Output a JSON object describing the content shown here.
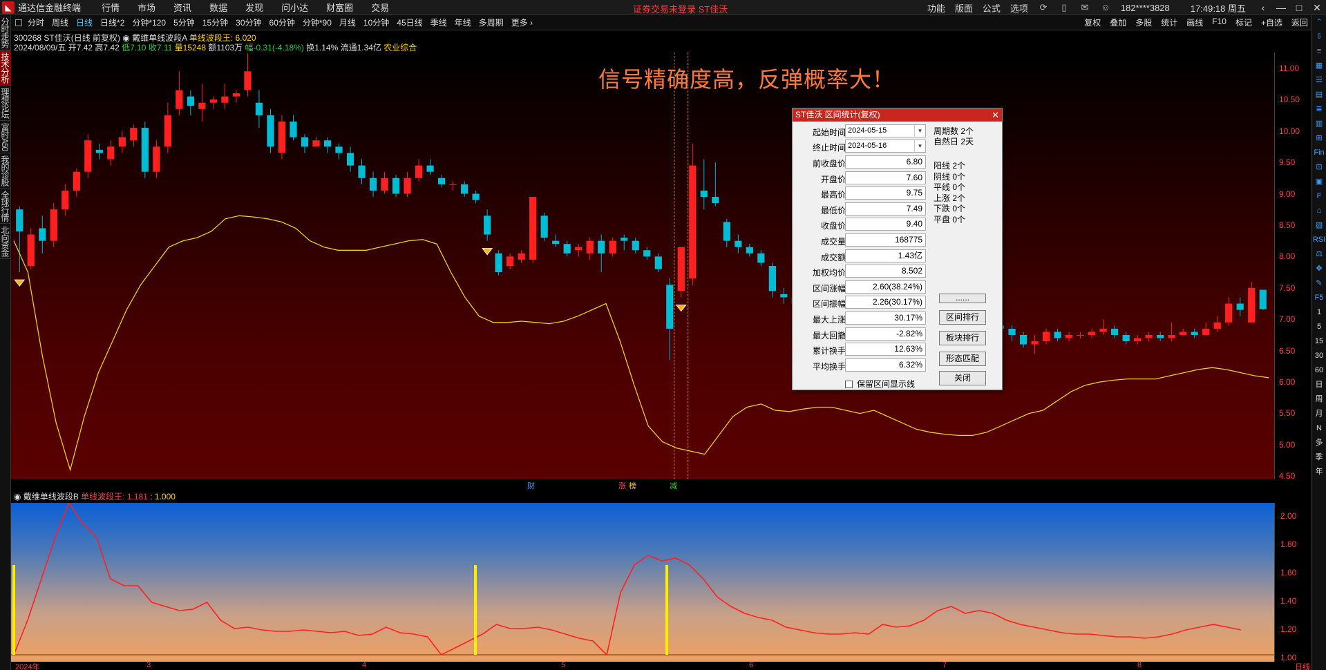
{
  "menubar": {
    "app_name": "通达信金融终端",
    "items": [
      "行情",
      "市场",
      "资讯",
      "数据",
      "发现",
      "问小达",
      "财富圈",
      "交易"
    ],
    "notice": "证券交易未登录  ST佳沃",
    "right_items": [
      "功能",
      "版面",
      "公式",
      "选项"
    ],
    "user": "182****3828",
    "clock": "17:49:18 周五",
    "window_buttons": [
      "‹",
      "—",
      "□",
      "✕"
    ]
  },
  "left_tabs": [
    "分时走势",
    "技术分析",
    "理想论坛",
    "富时A50",
    "我的诊股",
    "全球行情",
    "北向资金"
  ],
  "period_bar": {
    "periods": [
      "分时",
      "周线",
      "日线",
      "日线*2",
      "分钟*120",
      "5分钟",
      "15分钟",
      "30分钟",
      "60分钟",
      "分钟*90",
      "月线",
      "10分钟",
      "45日线",
      "季线",
      "年线",
      "多周期",
      "更多 ›"
    ],
    "active": "日线",
    "right": [
      "复权",
      "叠加",
      "多股",
      "统计",
      "画线",
      "F10",
      "标记",
      "+自选",
      "返回"
    ]
  },
  "info": {
    "line1_code": "300268 ST佳沃(日线 前复权)",
    "line1_indicator": "戴维单线波段A",
    "line1_value": "单线波段王: 6.020",
    "line2_date": "2024/08/09/五 开7.42 高7.42",
    "line2_low": "低7.10",
    "line2_close": "收7.11",
    "line2_vol": "量15248",
    "line2_amt": "额1103万",
    "line2_chg": "幅-0.31(-4.18%)",
    "line2_turn": "换1.14% 流通1.34亿",
    "line2_sector": "农业综合"
  },
  "headline": "信号精确度高，反弹概率大！",
  "high_marker": "11.19",
  "price_axis": [
    "11.00",
    "10.50",
    "10.00",
    "9.50",
    "9.00",
    "8.50",
    "8.00",
    "7.50",
    "7.00",
    "6.50",
    "6.00",
    "5.50",
    "5.00",
    "4.50"
  ],
  "event_markers": [
    {
      "label": "财",
      "color": "#4aa0ff"
    },
    {
      "label": "涨",
      "color": "#ff5050"
    },
    {
      "label": "榜",
      "color": "#ffd400"
    },
    {
      "label": "减",
      "color": "#40d040"
    }
  ],
  "indicator_panel": {
    "name": "戴维单线波段B",
    "label": "单线波段王:",
    "value1": "1.181",
    "value2": "1.000",
    "axis": [
      "2.00",
      "1.80",
      "1.60",
      "1.40",
      "1.20",
      "1.00"
    ]
  },
  "date_axis": [
    "2024年",
    "3",
    "4",
    "5",
    "6",
    "7",
    "8",
    "日线"
  ],
  "right_tools": [
    "⌃",
    "⇩",
    "≡",
    "▦",
    "☰",
    "▤",
    "≣",
    "▥",
    "⊞",
    "Fin",
    "⊡",
    "▣",
    "F",
    "⌂",
    "▧",
    "RSI",
    "⚖",
    "✥",
    "✎",
    "F5",
    "1",
    "5",
    "15",
    "30",
    "60",
    "日",
    "周",
    "月",
    "N",
    "多",
    "季",
    "年"
  ],
  "dialog": {
    "title": "ST佳沃  区间统计(复权)",
    "close": "✕",
    "start_label": "起始时间",
    "start_value": "2024-05-15",
    "end_label": "终止时间",
    "end_value": "2024-05-16",
    "rows": [
      {
        "label": "前收盘价",
        "value": "6.80"
      },
      {
        "label": "开盘价",
        "value": "7.60"
      },
      {
        "label": "最高价",
        "value": "9.75"
      },
      {
        "label": "最低价",
        "value": "7.49"
      },
      {
        "label": "收盘价",
        "value": "9.40"
      },
      {
        "label": "成交量",
        "value": "168775"
      },
      {
        "label": "成交额",
        "value": "1.43亿"
      },
      {
        "label": "加权均价",
        "value": "8.502"
      },
      {
        "label": "区间涨幅",
        "value": "2.60(38.24%)"
      },
      {
        "label": "区间振幅",
        "value": "2.26(30.17%)"
      },
      {
        "label": "最大上涨",
        "value": "30.17%"
      },
      {
        "label": "最大回撤",
        "value": "-2.82%"
      },
      {
        "label": "累计换手",
        "value": "12.63%"
      },
      {
        "label": "平均换手",
        "value": "6.32%"
      }
    ],
    "stats_top": [
      "周期数 2个",
      "自然日 2天"
    ],
    "stats_mid": [
      "阳线 2个",
      "阴线 0个",
      "平线 0个",
      "上涨 2个",
      "下跌 0个",
      "平盘 0个"
    ],
    "buttons": [
      "......",
      "区间排行",
      "板块排行",
      "形态匹配",
      "关闭"
    ],
    "checkbox": "保留区间显示线"
  },
  "chart_data": [
    {
      "type": "candlestick",
      "title": "300268 ST佳沃(日线 前复权)",
      "ylim": [
        4.4,
        11.2
      ],
      "up_color": "#ff2020",
      "down_color": "#00bcd4",
      "candles": [
        [
          8.7,
          8.35,
          8.75,
          7.7
        ],
        [
          7.8,
          8.3,
          8.4,
          7.75
        ],
        [
          8.4,
          8.2,
          8.6,
          8.0
        ],
        [
          8.2,
          8.7,
          8.8,
          8.1
        ],
        [
          8.7,
          9.0,
          9.1,
          8.6
        ],
        [
          9.0,
          9.3,
          9.35,
          8.9
        ],
        [
          9.3,
          9.8,
          9.9,
          9.2
        ],
        [
          9.65,
          9.6,
          9.75,
          9.5
        ],
        [
          9.5,
          9.7,
          9.8,
          9.4
        ],
        [
          9.7,
          9.85,
          9.95,
          9.6
        ],
        [
          9.8,
          10.0,
          10.05,
          9.7
        ],
        [
          10.0,
          9.3,
          10.1,
          9.2
        ],
        [
          9.3,
          9.7,
          9.8,
          9.2
        ],
        [
          9.7,
          10.2,
          10.4,
          9.6
        ],
        [
          10.3,
          10.6,
          10.9,
          10.2
        ],
        [
          10.5,
          10.35,
          10.6,
          10.2
        ],
        [
          10.3,
          10.4,
          10.7,
          10.1
        ],
        [
          10.4,
          10.45,
          10.5,
          10.3
        ],
        [
          10.4,
          10.5,
          10.7,
          10.3
        ],
        [
          10.5,
          10.55,
          10.6,
          10.4
        ],
        [
          10.6,
          10.9,
          11.19,
          10.5
        ],
        [
          10.4,
          10.2,
          10.6,
          10.0
        ],
        [
          10.2,
          9.7,
          10.3,
          9.6
        ],
        [
          9.6,
          10.1,
          10.2,
          9.5
        ],
        [
          10.1,
          9.85,
          10.2,
          9.8
        ],
        [
          9.85,
          9.7,
          9.9,
          9.6
        ],
        [
          9.7,
          9.8,
          9.85,
          9.7
        ],
        [
          9.8,
          9.7,
          9.85,
          9.6
        ],
        [
          9.7,
          9.6,
          9.75,
          9.5
        ],
        [
          9.6,
          9.4,
          9.7,
          9.3
        ],
        [
          9.4,
          9.2,
          9.5,
          9.1
        ],
        [
          9.2,
          9.0,
          9.3,
          8.9
        ],
        [
          9.0,
          9.2,
          9.3,
          8.95
        ],
        [
          9.2,
          8.95,
          9.25,
          8.9
        ],
        [
          8.95,
          9.2,
          9.3,
          8.9
        ],
        [
          9.2,
          9.4,
          9.5,
          9.15
        ],
        [
          9.4,
          9.3,
          9.5,
          9.25
        ],
        [
          9.2,
          9.1,
          9.25,
          9.05
        ],
        [
          9.1,
          9.1,
          9.15,
          9.0
        ],
        [
          9.1,
          8.95,
          9.15,
          8.9
        ],
        [
          8.95,
          8.85,
          9.0,
          8.8
        ],
        [
          8.6,
          8.3,
          8.7,
          8.2
        ],
        [
          8.0,
          7.7,
          8.05,
          7.65
        ],
        [
          7.8,
          7.95,
          8.0,
          7.75
        ],
        [
          7.9,
          8.0,
          8.05,
          7.85
        ],
        [
          7.9,
          8.9,
          8.9,
          7.85
        ],
        [
          8.6,
          8.25,
          8.65,
          8.2
        ],
        [
          8.2,
          8.15,
          8.3,
          8.1
        ],
        [
          8.15,
          8.0,
          8.2,
          7.95
        ],
        [
          8.05,
          8.1,
          8.15,
          7.95
        ],
        [
          8.0,
          8.2,
          8.25,
          7.9
        ],
        [
          8.2,
          8.0,
          8.3,
          7.7
        ],
        [
          8.0,
          8.2,
          8.25,
          7.95
        ],
        [
          8.25,
          8.2,
          8.3,
          8.05
        ],
        [
          8.2,
          8.05,
          8.25,
          8.0
        ],
        [
          8.05,
          7.95,
          8.1,
          7.9
        ],
        [
          7.95,
          7.75,
          8.0,
          7.7
        ],
        [
          7.5,
          6.8,
          7.6,
          6.3
        ],
        [
          7.4,
          8.1,
          8.1,
          7.3
        ],
        [
          7.6,
          9.4,
          9.75,
          7.49
        ],
        [
          9.0,
          8.9,
          9.5,
          8.7
        ],
        [
          8.9,
          8.8,
          9.45,
          8.75
        ],
        [
          8.5,
          8.2,
          8.55,
          8.1
        ],
        [
          8.2,
          8.1,
          8.3,
          8.0
        ],
        [
          8.1,
          8.0,
          8.15,
          7.95
        ],
        [
          8.0,
          7.85,
          8.05,
          7.8
        ],
        [
          7.8,
          7.4,
          7.85,
          7.3
        ],
        [
          7.35,
          7.3,
          7.45,
          7.2
        ],
        [
          7.3,
          7.2,
          7.35,
          7.05
        ],
        [
          7.2,
          7.15,
          7.25,
          7.1
        ],
        [
          7.15,
          6.9,
          7.2,
          6.8
        ],
        [
          6.9,
          7.0,
          7.1,
          6.85
        ],
        [
          6.95,
          6.9,
          7.0,
          6.85
        ],
        [
          6.8,
          6.4,
          6.9,
          6.3
        ],
        [
          6.55,
          6.6,
          6.7,
          6.5
        ],
        [
          6.65,
          6.7,
          6.75,
          6.6
        ],
        [
          6.7,
          6.75,
          6.8,
          6.65
        ],
        [
          6.75,
          6.8,
          6.85,
          6.7
        ],
        [
          6.8,
          6.75,
          6.85,
          6.7
        ],
        [
          6.75,
          6.7,
          6.8,
          6.65
        ],
        [
          6.7,
          6.75,
          6.8,
          6.65
        ],
        [
          6.7,
          6.8,
          6.9,
          6.7
        ],
        [
          6.8,
          6.75,
          6.85,
          6.7
        ],
        [
          6.75,
          6.9,
          6.95,
          6.7
        ],
        [
          6.9,
          6.9,
          7.0,
          6.8
        ],
        [
          6.9,
          6.85,
          6.95,
          6.8
        ],
        [
          6.85,
          6.8,
          6.9,
          6.75
        ],
        [
          6.8,
          6.7,
          6.85,
          6.6
        ],
        [
          6.7,
          6.55,
          6.75,
          6.5
        ],
        [
          6.55,
          6.6,
          6.7,
          6.4
        ],
        [
          6.6,
          6.75,
          6.8,
          6.55
        ],
        [
          6.75,
          6.65,
          6.8,
          6.6
        ],
        [
          6.65,
          6.7,
          6.75,
          6.6
        ],
        [
          6.7,
          6.7,
          6.75,
          6.65
        ],
        [
          6.7,
          6.75,
          6.8,
          6.65
        ],
        [
          6.75,
          6.8,
          6.95,
          6.7
        ],
        [
          6.8,
          6.7,
          6.85,
          6.65
        ],
        [
          6.7,
          6.6,
          6.75,
          6.55
        ],
        [
          6.6,
          6.65,
          6.7,
          6.55
        ],
        [
          6.65,
          6.7,
          6.75,
          6.6
        ],
        [
          6.7,
          6.65,
          6.75,
          6.6
        ],
        [
          6.65,
          6.7,
          6.9,
          6.6
        ],
        [
          6.7,
          6.75,
          6.8,
          6.7
        ],
        [
          6.75,
          6.7,
          6.8,
          6.65
        ],
        [
          6.7,
          6.8,
          6.9,
          6.7
        ],
        [
          6.8,
          6.9,
          7.0,
          6.75
        ],
        [
          6.9,
          7.2,
          7.3,
          6.85
        ],
        [
          7.2,
          7.1,
          7.3,
          7.0
        ],
        [
          6.9,
          7.45,
          7.55,
          6.9
        ],
        [
          7.42,
          7.11,
          7.42,
          7.1
        ]
      ],
      "line": {
        "name": "单线波段王",
        "color": "#e8d020",
        "values": [
          8.2,
          7.7,
          6.4,
          5.3,
          4.55,
          5.4,
          6.1,
          6.6,
          7.1,
          7.5,
          7.8,
          8.1,
          8.2,
          8.25,
          8.35,
          8.55,
          8.6,
          8.58,
          8.55,
          8.5,
          8.4,
          8.2,
          8.1,
          8.05,
          8.05,
          8.05,
          8.1,
          8.15,
          8.2,
          8.22,
          8.15,
          7.7,
          7.3,
          7.0,
          6.9,
          6.9,
          6.92,
          6.9,
          6.88,
          6.92,
          7.0,
          7.1,
          7.2,
          6.6,
          5.9,
          5.25,
          5.0,
          4.9,
          4.85,
          4.8,
          5.1,
          5.4,
          5.55,
          5.6,
          5.5,
          5.48,
          5.52,
          5.55,
          5.55,
          5.5,
          5.45,
          5.5,
          5.4,
          5.3,
          5.2,
          5.15,
          5.12,
          5.1,
          5.1,
          5.15,
          5.25,
          5.35,
          5.45,
          5.5,
          5.65,
          5.8,
          5.9,
          5.95,
          5.98,
          6.0,
          6.0,
          6.0,
          6.05,
          6.1,
          6.15,
          6.18,
          6.15,
          6.1,
          6.05,
          6.02
        ]
      },
      "signals": [
        0,
        41,
        58
      ]
    },
    {
      "type": "line",
      "title": "戴维单线波段B",
      "ylim": [
        0.95,
        2.1
      ],
      "series": [
        {
          "name": "单线波段王",
          "color": "#ff2020",
          "values": [
            1.0,
            1.25,
            1.55,
            1.85,
            2.1,
            1.95,
            1.85,
            1.55,
            1.5,
            1.5,
            1.38,
            1.35,
            1.32,
            1.33,
            1.38,
            1.25,
            1.19,
            1.2,
            1.18,
            1.17,
            1.17,
            1.18,
            1.17,
            1.16,
            1.17,
            1.14,
            1.15,
            1.2,
            1.16,
            1.15,
            1.13,
            1.0,
            1.05,
            1.1,
            1.15,
            1.22,
            1.19,
            1.19,
            1.2,
            1.18,
            1.15,
            1.12,
            1.1,
            1.0,
            1.45,
            1.65,
            1.72,
            1.68,
            1.7,
            1.65,
            1.55,
            1.42,
            1.35,
            1.3,
            1.27,
            1.25,
            1.2,
            1.18,
            1.16,
            1.15,
            1.15,
            1.16,
            1.15,
            1.22,
            1.2,
            1.21,
            1.25,
            1.32,
            1.35,
            1.3,
            1.32,
            1.3,
            1.25,
            1.22,
            1.2,
            1.18,
            1.16,
            1.15,
            1.15,
            1.14,
            1.13,
            1.13,
            1.12,
            1.13,
            1.15,
            1.18,
            1.2,
            1.22,
            1.2,
            1.18
          ]
        }
      ],
      "signals": [
        0,
        41,
        58
      ]
    }
  ]
}
